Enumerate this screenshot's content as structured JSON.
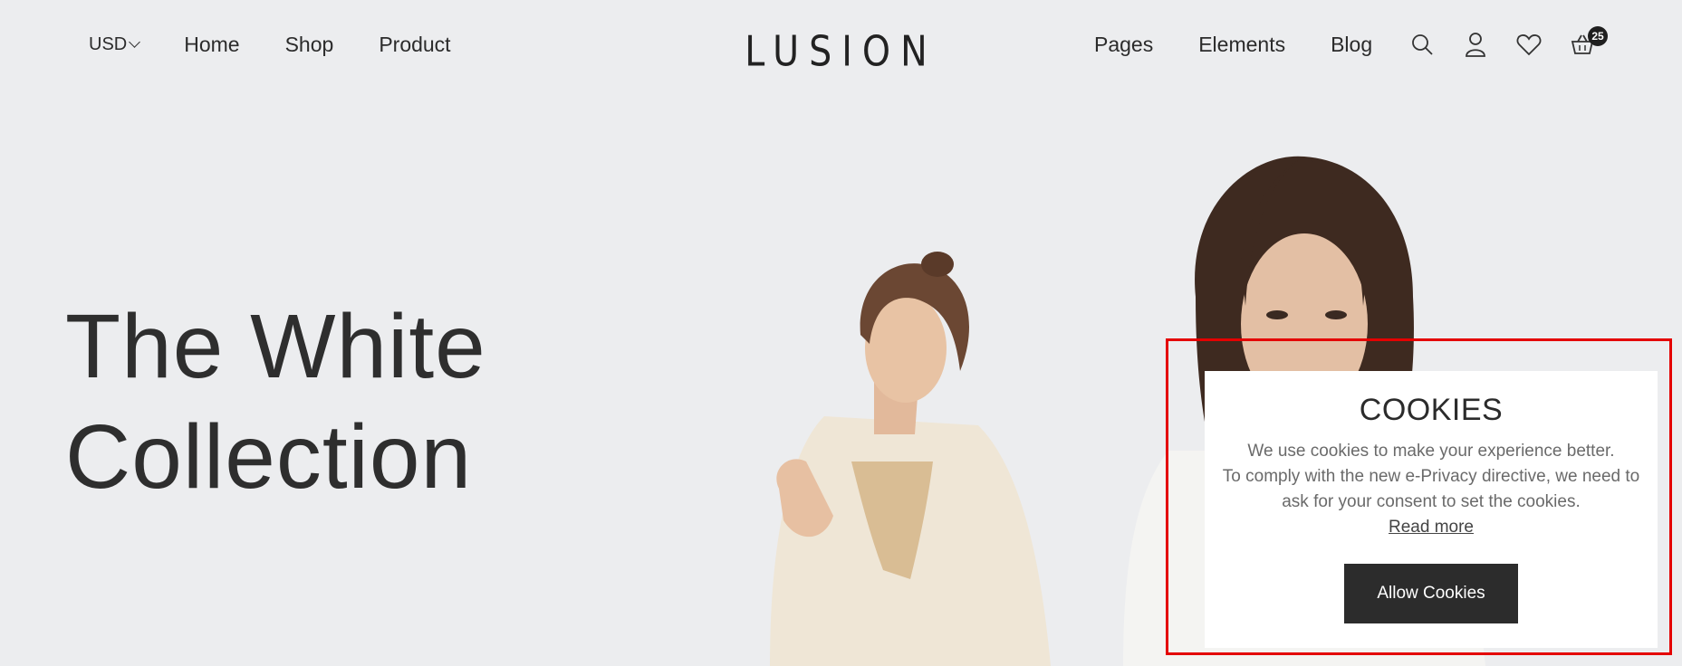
{
  "header": {
    "currency": "USD",
    "nav_left": [
      "Home",
      "Shop",
      "Product"
    ],
    "logo": "LUSION",
    "nav_right": [
      "Pages",
      "Elements",
      "Blog"
    ],
    "cart_count": "25",
    "icons": [
      "search-icon",
      "user-icon",
      "heart-icon",
      "cart-icon"
    ]
  },
  "hero": {
    "title_line1": "The White",
    "title_line2": "Collection"
  },
  "cookies": {
    "title": "COOKIES",
    "line1": "We use cookies to make your experience better.",
    "line2": "To comply with the new e-Privacy directive, we need to",
    "line3": "ask for your consent to set the cookies.",
    "read_more": "Read more",
    "button": "Allow Cookies"
  },
  "colors": {
    "background": "#ecedef",
    "button": "#2c2c2c",
    "highlight": "#e40000"
  }
}
